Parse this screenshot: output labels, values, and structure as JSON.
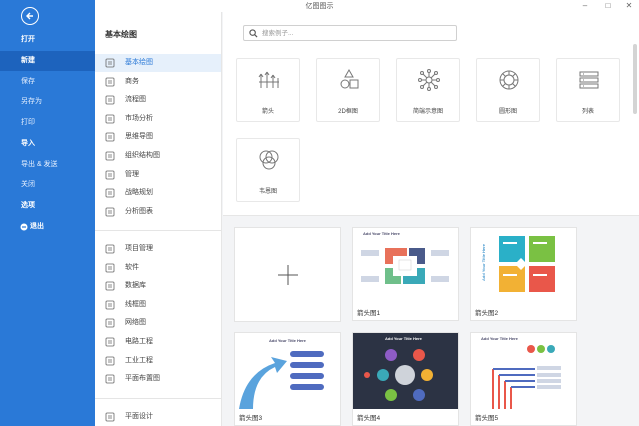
{
  "window": {
    "title": "亿图图示",
    "minimize": "–",
    "maximize": "□",
    "close": "✕"
  },
  "leftnav": {
    "items": [
      {
        "label": "打开",
        "style": "bold"
      },
      {
        "label": "新建",
        "style": "active"
      },
      {
        "label": "保存",
        "style": "normal"
      },
      {
        "label": "另存为",
        "style": "normal"
      },
      {
        "label": "打印",
        "style": "normal"
      },
      {
        "label": "导入",
        "style": "bold"
      },
      {
        "label": "导出 & 发送",
        "style": "normal"
      },
      {
        "label": "关闭",
        "style": "normal"
      },
      {
        "label": "选项",
        "style": "bold"
      },
      {
        "label": "退出",
        "style": "bold"
      }
    ]
  },
  "sidebar": {
    "heading": "基本绘图",
    "group1": [
      "基本绘图",
      "商务",
      "流程图",
      "市场分析",
      "思维导图",
      "组织结构图",
      "管理",
      "战略规划",
      "分析图表"
    ],
    "group2": [
      "项目管理",
      "软件",
      "数据库",
      "线框图",
      "网络图",
      "电路工程",
      "工业工程",
      "平面布置图"
    ],
    "group3": [
      "平面设计"
    ]
  },
  "search": {
    "placeholder": "搜索例子..."
  },
  "tiles": [
    "箭头",
    "2D框图",
    "简端示意图",
    "圆形图",
    "列表",
    "韦恩图"
  ],
  "templates": {
    "cards": [
      {
        "label": ""
      },
      {
        "label": "箭头图1",
        "title": "Add Your Title Here"
      },
      {
        "label": "箭头图2",
        "title": "Add Your Title Here"
      },
      {
        "label": "箭头图3",
        "title": "Add Your Title Here"
      },
      {
        "label": "箭头图4",
        "title": "Add Your Title Here"
      },
      {
        "label": "箭头图5",
        "title": "Add Your Title Here"
      }
    ]
  },
  "colors": {
    "nav": "#2a79d7",
    "nav_active": "#1d63bd",
    "accent": "#2a79d7"
  }
}
